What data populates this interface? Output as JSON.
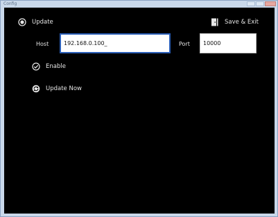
{
  "window": {
    "title": "Config"
  },
  "toolbar": {
    "update_label": "Update",
    "save_exit_label": "Save & Exit"
  },
  "form": {
    "host_label": "Host",
    "host_value": "192.168.0.100_",
    "port_label": "Port",
    "port_value": "10000"
  },
  "options": {
    "enable_label": "Enable",
    "update_now_label": "Update Now"
  },
  "colors": {
    "background": "#000000",
    "text": "#e6e6e6",
    "focus_border": "#2b5fb8"
  }
}
